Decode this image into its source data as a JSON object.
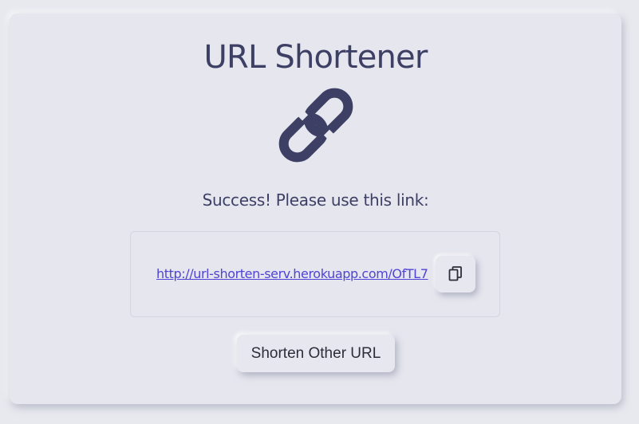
{
  "app": {
    "title": "URL Shortener",
    "logo_icon": "link-icon",
    "accent_color": "#3d4064"
  },
  "result": {
    "message": "Success! Please use this link:",
    "short_url": "http://url-shorten-serv.herokuapp.com/OfTL7",
    "copy_icon": "copy-icon"
  },
  "actions": {
    "shorten_other_label": "Shorten Other URL"
  }
}
